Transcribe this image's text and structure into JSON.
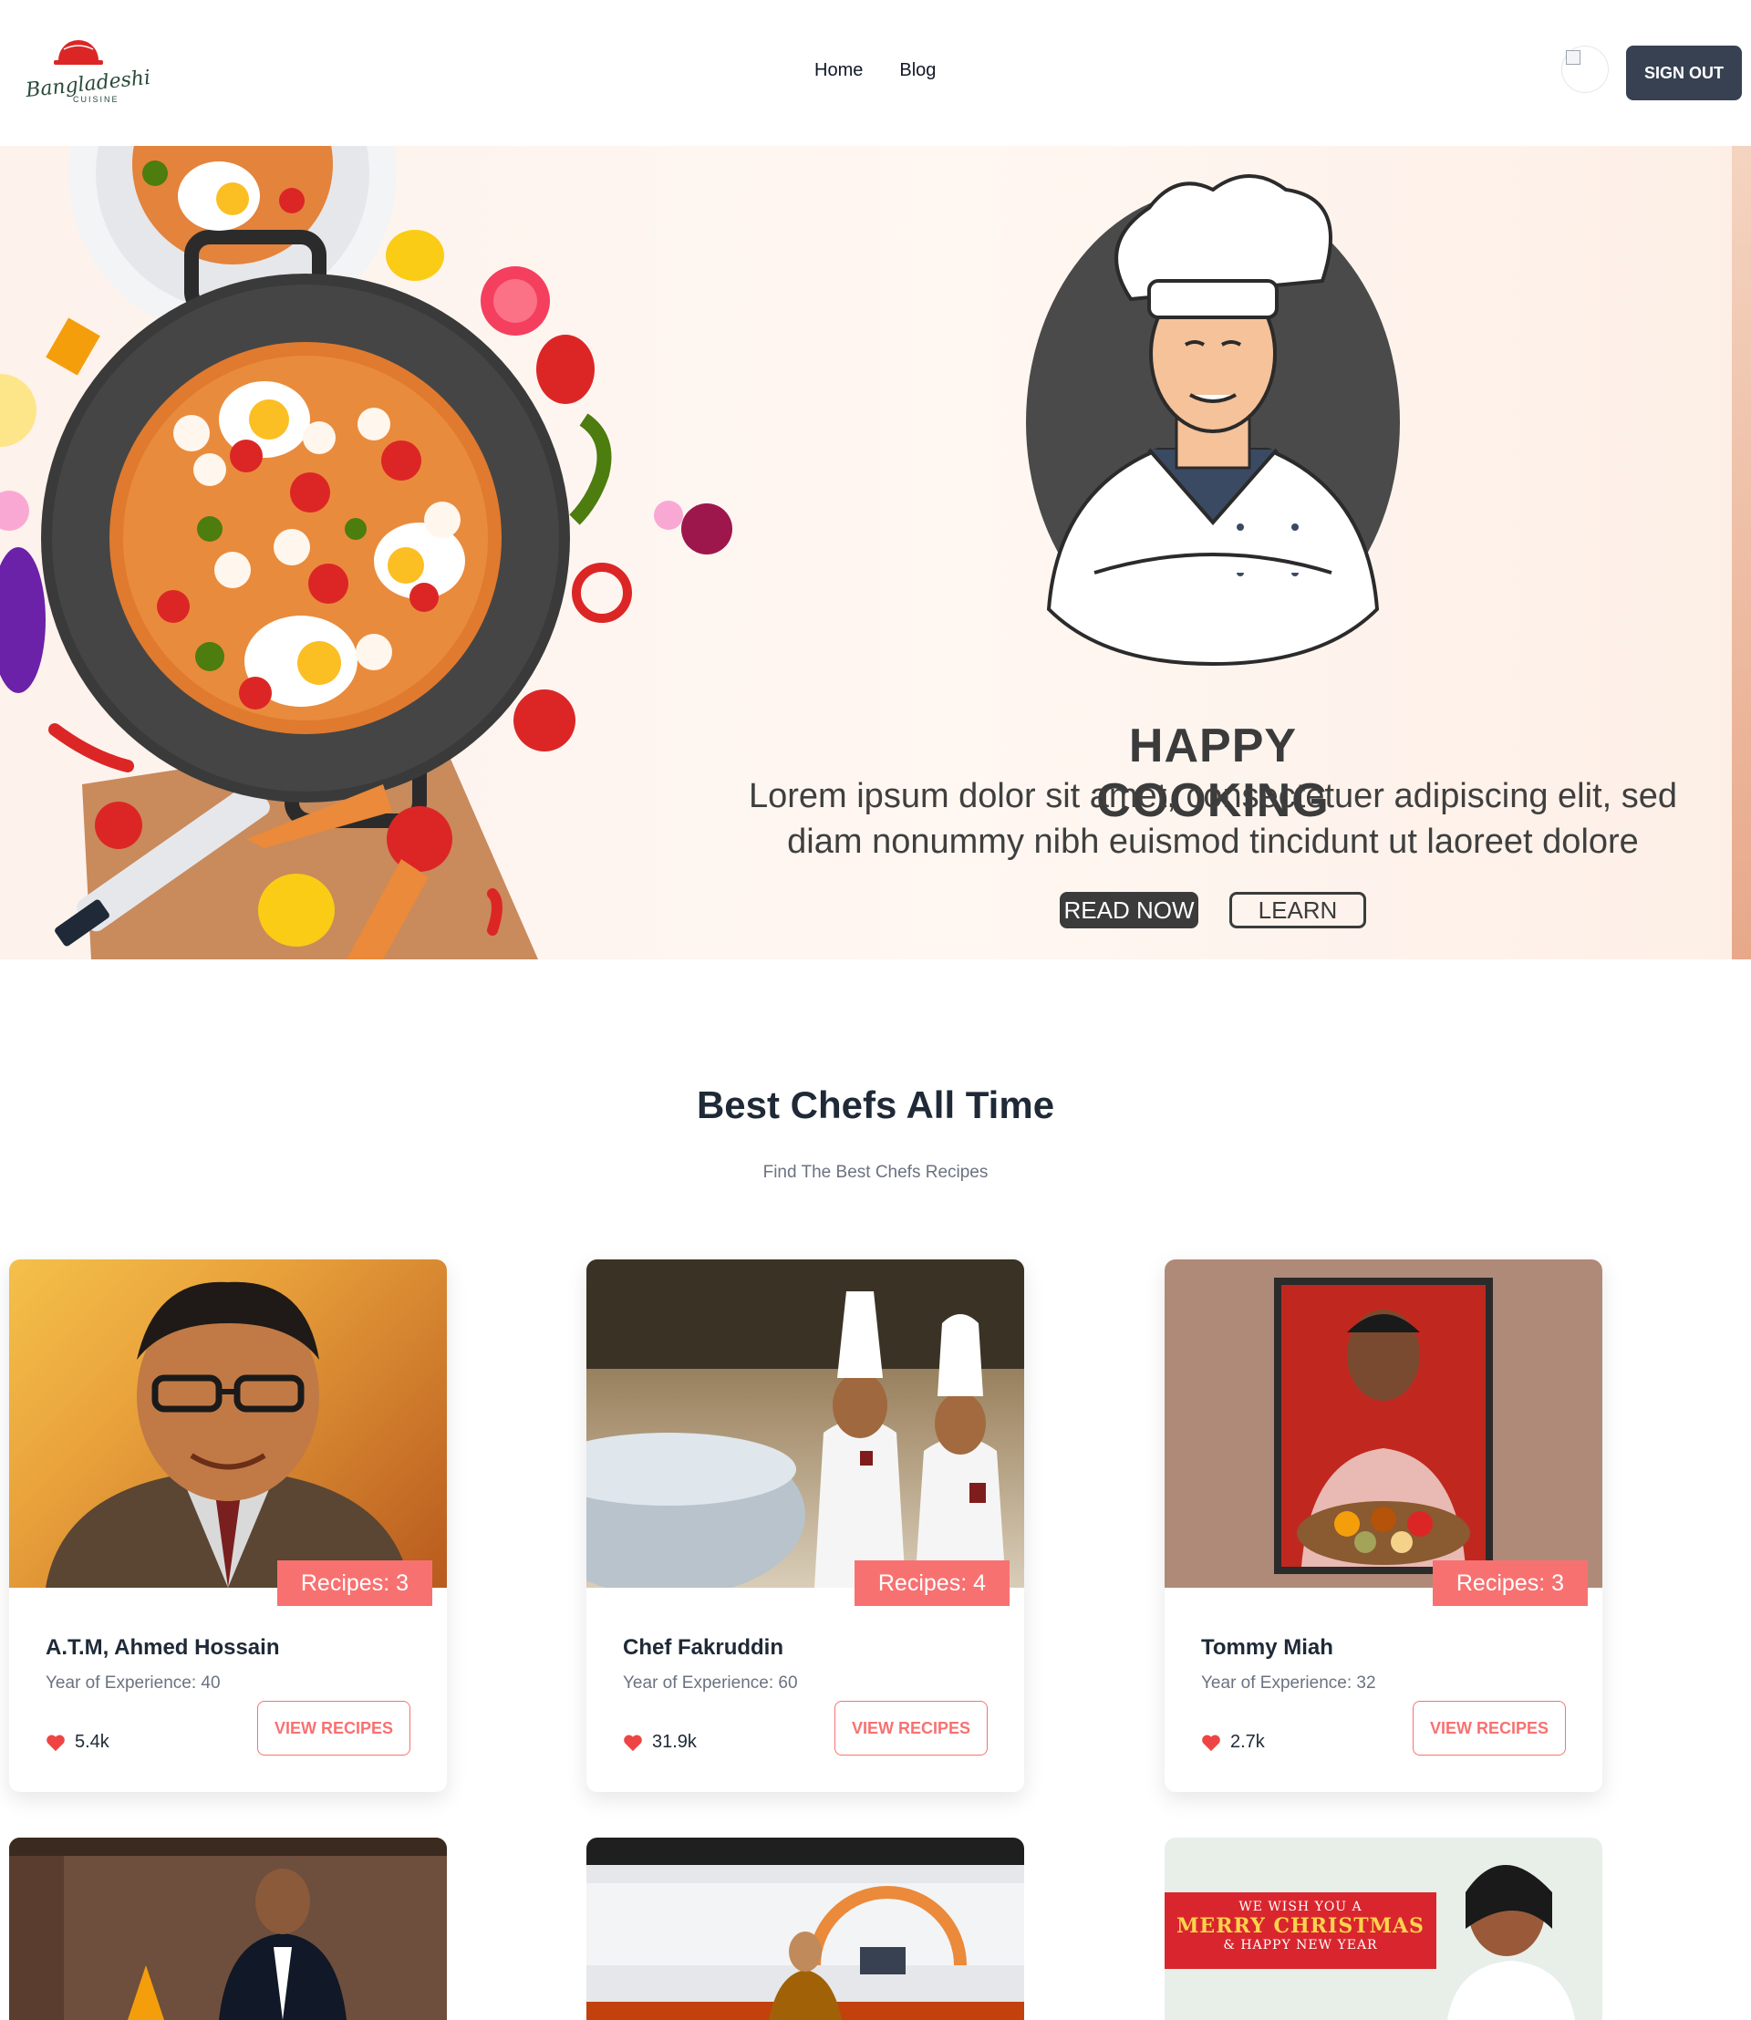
{
  "brand": {
    "logo_script": "Bangladeshi",
    "logo_sub": "CUISINE"
  },
  "nav": {
    "home": "Home",
    "blog": "Blog",
    "signout": "SIGN OUT"
  },
  "hero": {
    "title": "HAPPY COOKING",
    "text": "Lorem ipsum dolor sit amet, consectetuer adipiscing elit, sed diam nonummy nibh euismod tincidunt ut laoreet dolore",
    "read_now": "READ NOW",
    "learn": "LEARN"
  },
  "section": {
    "title": "Best Chefs All Time",
    "subtitle": "Find The Best Chefs Recipes"
  },
  "chefs": [
    {
      "name": "A.T.M, Ahmed Hossain",
      "experience": "Year of Experience: 40",
      "recipes": "Recipes: 3",
      "likes": "5.4k",
      "button": "VIEW RECIPES"
    },
    {
      "name": "Chef Fakruddin",
      "experience": "Year of Experience: 60",
      "recipes": "Recipes: 4",
      "likes": "31.9k",
      "button": "VIEW RECIPES"
    },
    {
      "name": "Tommy Miah",
      "experience": "Year of Experience: 32",
      "recipes": "Recipes: 3",
      "likes": "2.7k",
      "button": "VIEW RECIPES"
    }
  ],
  "promo": {
    "line1": "WE WISH YOU A",
    "line2": "MERRY CHRISTMAS",
    "line3": "& HAPPY NEW YEAR"
  },
  "colors": {
    "accent": "#f87171",
    "dark_button": "#374151",
    "heading": "#1f2937",
    "muted": "#6b7280"
  }
}
